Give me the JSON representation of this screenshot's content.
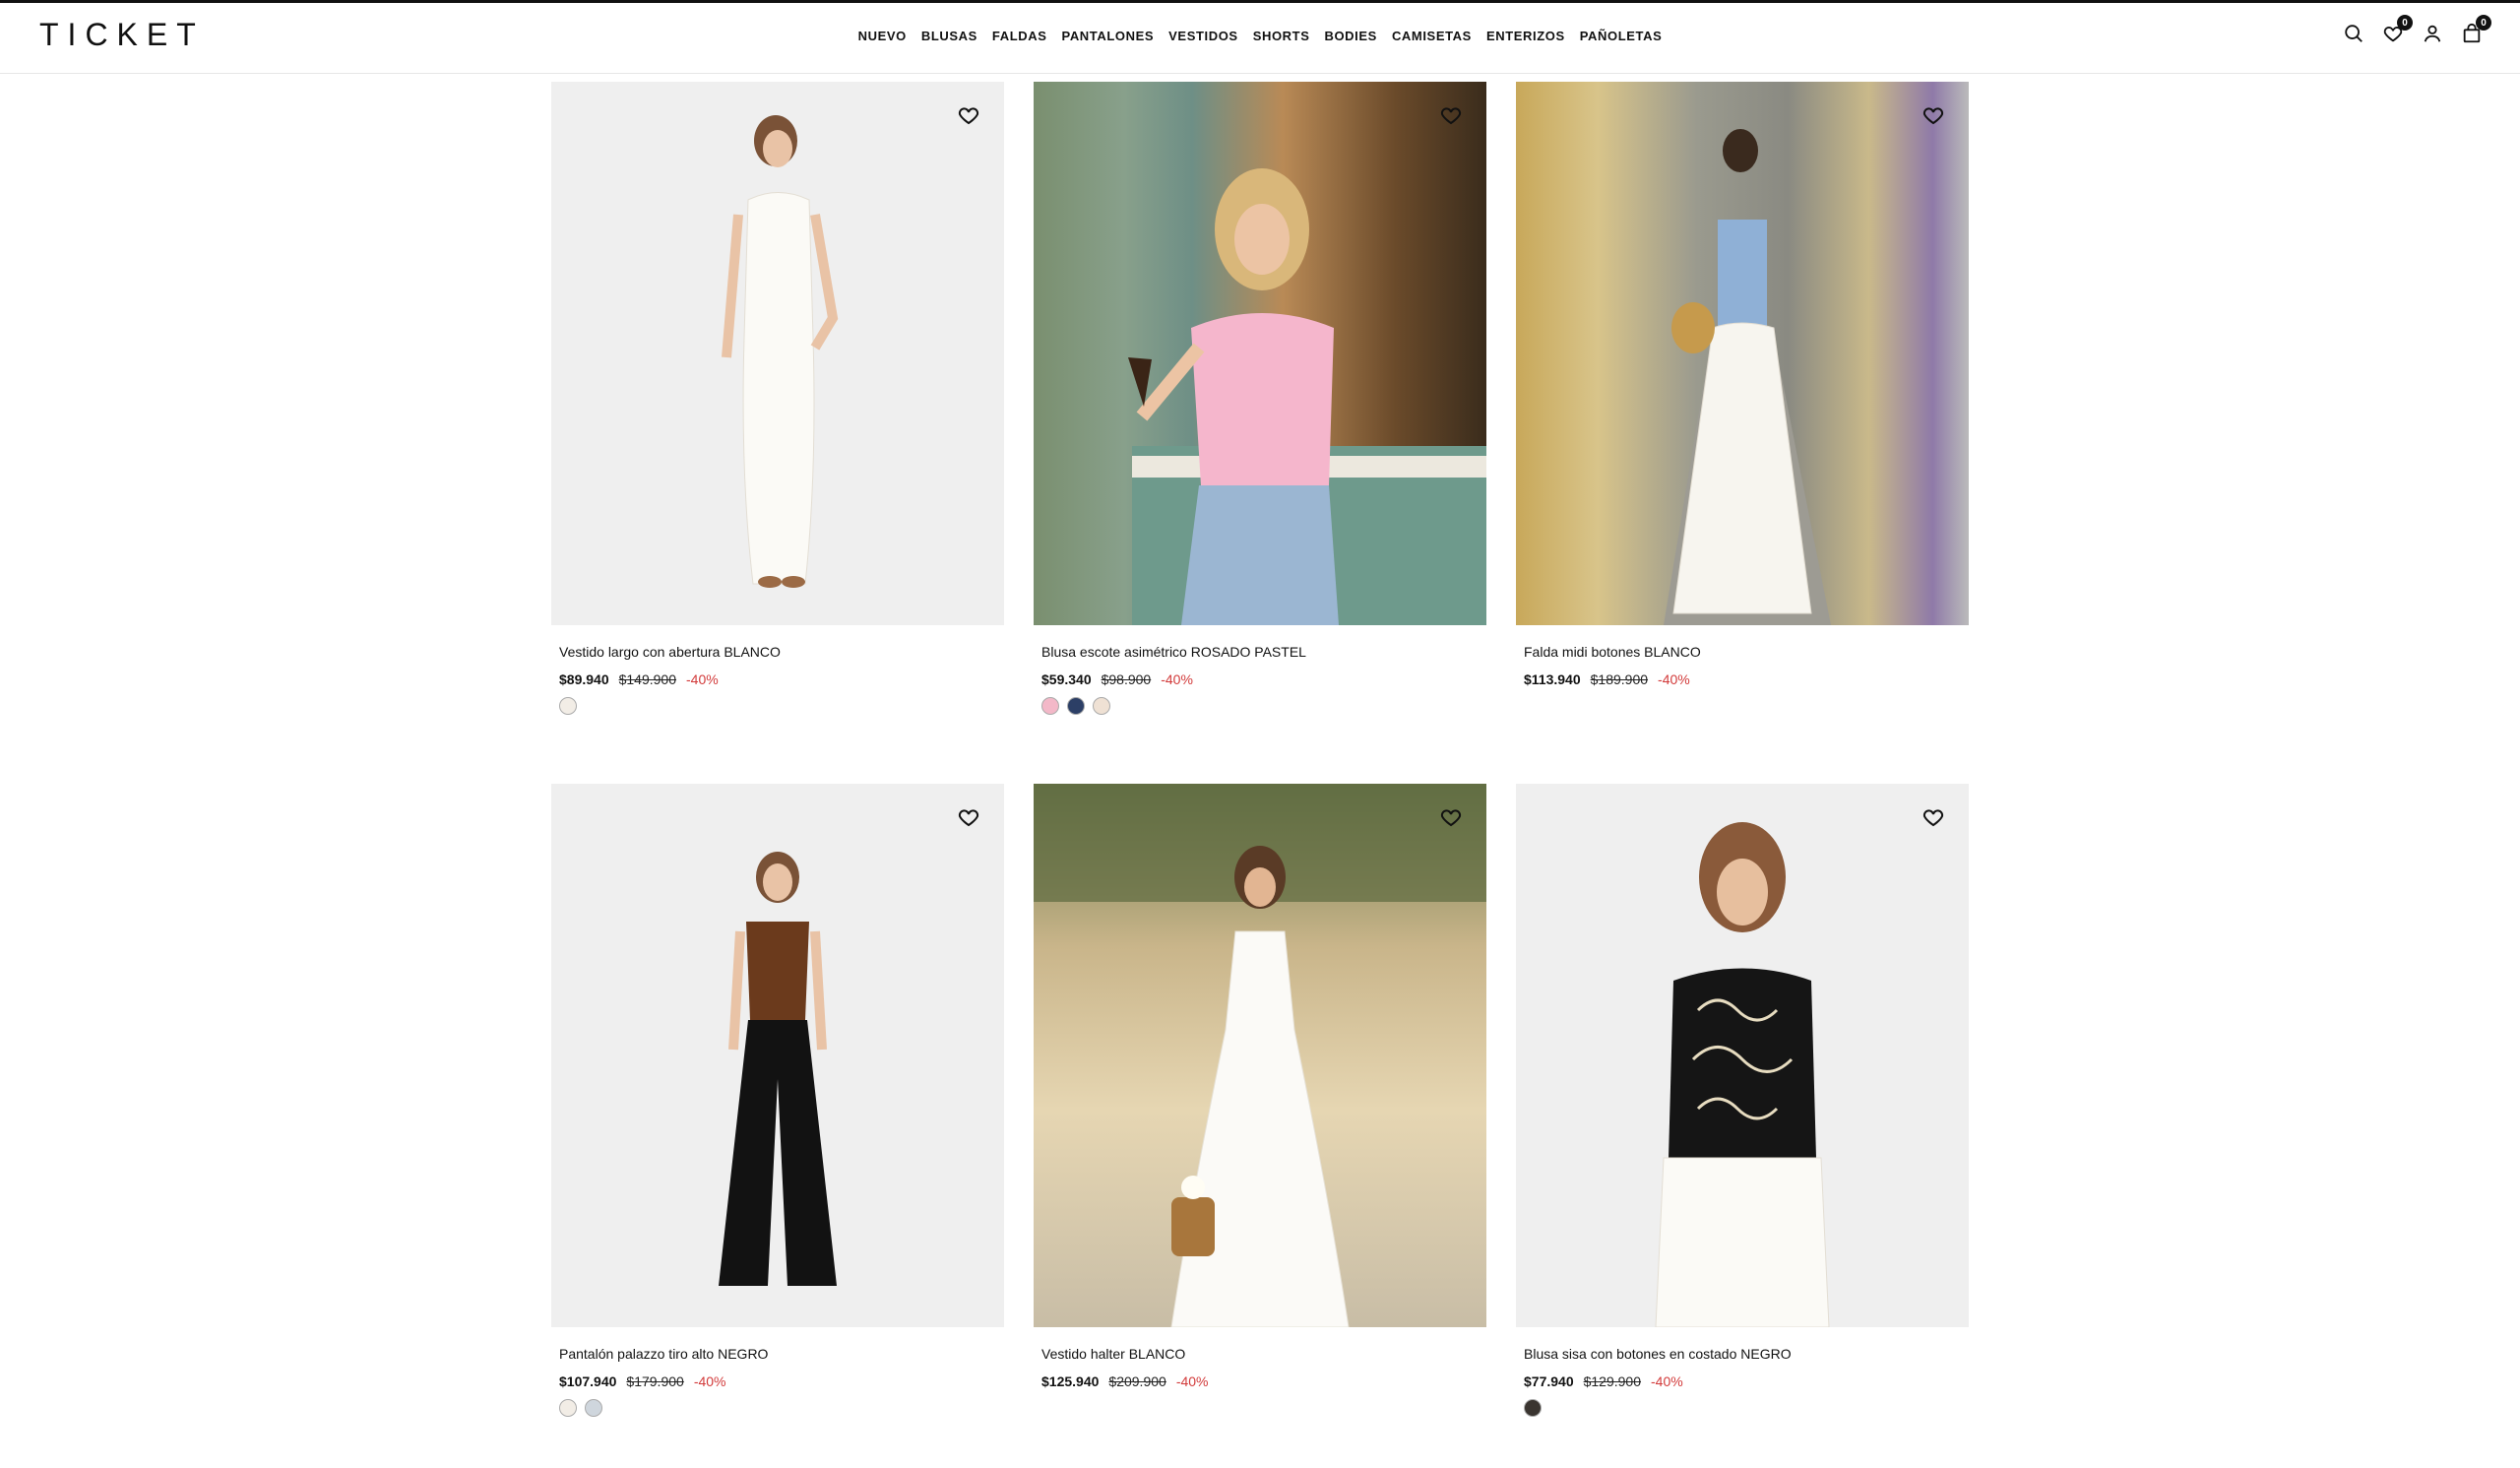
{
  "brand": {
    "logo": "TICKET"
  },
  "nav": [
    {
      "label": "NUEVO"
    },
    {
      "label": "BLUSAS"
    },
    {
      "label": "FALDAS"
    },
    {
      "label": "PANTALONES"
    },
    {
      "label": "VESTIDOS"
    },
    {
      "label": "SHORTS"
    },
    {
      "label": "BODIES"
    },
    {
      "label": "CAMISETAS"
    },
    {
      "label": "ENTERIZOS"
    },
    {
      "label": "PAÑOLETAS"
    }
  ],
  "header_icons": {
    "search": "search-icon",
    "wishlist": {
      "icon": "heart-icon",
      "count": "0"
    },
    "account": "user-icon",
    "cart": {
      "icon": "bag-icon",
      "count": "0"
    }
  },
  "products": [
    {
      "name": "Vestido largo con abertura BLANCO",
      "price": "$89.940",
      "old_price": "$149.900",
      "discount": "-40%",
      "swatches": [
        "#f2ede6"
      ]
    },
    {
      "name": "Blusa escote asimétrico ROSADO PASTEL",
      "price": "$59.340",
      "old_price": "$98.900",
      "discount": "-40%",
      "swatches": [
        "#f3b8c8",
        "#2c3f66",
        "#efe1d4"
      ]
    },
    {
      "name": "Falda midi botones BLANCO",
      "price": "$113.940",
      "old_price": "$189.900",
      "discount": "-40%",
      "swatches": []
    },
    {
      "name": "Pantalón palazzo tiro alto NEGRO",
      "price": "$107.940",
      "old_price": "$179.900",
      "discount": "-40%",
      "swatches": [
        "#f2ede6",
        "#cfd6dd"
      ]
    },
    {
      "name": "Vestido halter BLANCO",
      "price": "$125.940",
      "old_price": "$209.900",
      "discount": "-40%",
      "swatches": []
    },
    {
      "name": "Blusa sisa con botones en costado NEGRO",
      "price": "$77.940",
      "old_price": "$129.900",
      "discount": "-40%",
      "swatches": [
        "#3a3530"
      ]
    }
  ],
  "colors": {
    "discount": "#d23a3a",
    "text": "#111111"
  }
}
